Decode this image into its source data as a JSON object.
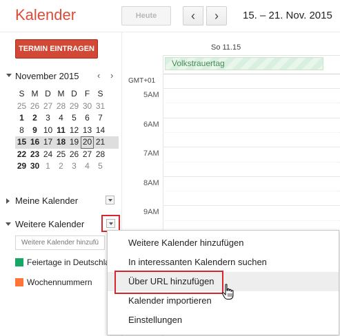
{
  "header": {
    "app_title": "Kalender",
    "today_label": "Heute",
    "prev_glyph": "‹",
    "next_glyph": "›",
    "date_range": "15. – 21. Nov. 2015"
  },
  "create_button": "TERMIN EINTRAGEN",
  "mini_calendar": {
    "title": "November 2015",
    "prev_glyph": "‹",
    "next_glyph": "›",
    "weekday_headers": [
      "S",
      "M",
      "D",
      "M",
      "D",
      "F",
      "S"
    ],
    "weeks": [
      [
        "25",
        "26",
        "27",
        "28",
        "29",
        "30",
        "31"
      ],
      [
        "1",
        "2",
        "3",
        "4",
        "5",
        "6",
        "7"
      ],
      [
        "8",
        "9",
        "10",
        "11",
        "12",
        "13",
        "14"
      ],
      [
        "15",
        "16",
        "17",
        "18",
        "19",
        "20",
        "21"
      ],
      [
        "22",
        "23",
        "24",
        "25",
        "26",
        "27",
        "28"
      ],
      [
        "29",
        "30",
        "1",
        "2",
        "3",
        "4",
        "5"
      ]
    ]
  },
  "sidebar": {
    "my_calendars_label": "Meine Kalender",
    "other_calendars_label": "Weitere Kalender",
    "add_calendar_placeholder": "Weitere Kalender hinzufügen",
    "calendars": [
      {
        "name": "Feiertage in Deutschland",
        "color": "#16a765"
      },
      {
        "name": "Wochennummern",
        "color": "#ff7537"
      }
    ]
  },
  "week_view": {
    "day_header": "So 11.15",
    "allday_event": "Volkstrauertag",
    "timezone_label": "GMT+01",
    "hours": [
      "5AM",
      "6AM",
      "7AM",
      "8AM",
      "9AM"
    ]
  },
  "dropdown_menu": {
    "items": [
      "Weitere Kalender hinzufügen",
      "In interessanten Kalendern suchen",
      "Über URL hinzufügen",
      "Kalender importieren",
      "Einstellungen"
    ],
    "highlighted_index": 2
  },
  "colors": {
    "brand": "#dd4b39",
    "create_button": "#d14836",
    "highlight_box": "#d9252a"
  }
}
